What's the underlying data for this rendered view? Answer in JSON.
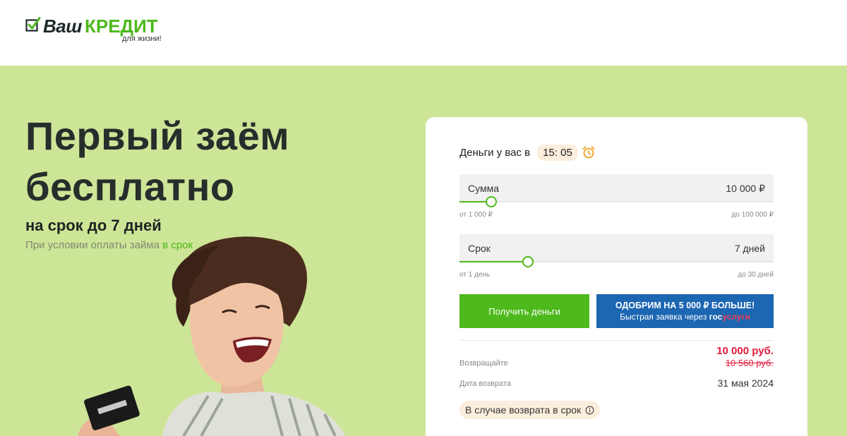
{
  "brand": {
    "name_part1": "Ваш",
    "name_part2": "КРЕДИТ",
    "tagline": "для жизни!",
    "accent_color": "#4db91c"
  },
  "hero": {
    "title": "Первый заём бесплатно",
    "subtitle": "на срок до 7 дней",
    "condition_text": "При условии оплаты займа ",
    "condition_highlight": "в срок",
    "background_color": "#cde597"
  },
  "card": {
    "timer_label": "Деньги у вас в",
    "timer_value": "15: 05",
    "timer_icon": "alarm-clock-icon",
    "amount": {
      "label": "Сумма",
      "value": "10 000 ₽",
      "min_label": "от 1 000 ₽",
      "max_label": "до 100 000 ₽",
      "position": 0.1
    },
    "term": {
      "label": "Срок",
      "value": "7 дней",
      "min_label": "от 1 день",
      "max_label": "до 30 дней",
      "position": 0.217
    },
    "get_money_button": "Получить деньги",
    "gosuslugi_button": {
      "line1": "ОДОБРИМ НА 5 000 ₽ БОЛЬШЕ!",
      "line2": "Быстрая заявка через ",
      "brand_part1": "гос",
      "brand_part2": "услуги"
    },
    "return_label": "Возвращайте",
    "return_amount": "10 000 руб.",
    "return_old_amount": "10 560 руб.",
    "date_label": "Дата возврата",
    "date_value": "31 мая 2024",
    "badge_text": "В случае возврата в срок",
    "badge_icon": "info-icon",
    "button_green": "#4db91c",
    "button_blue": "#1c66b2",
    "price_red": "#e21b3c"
  }
}
